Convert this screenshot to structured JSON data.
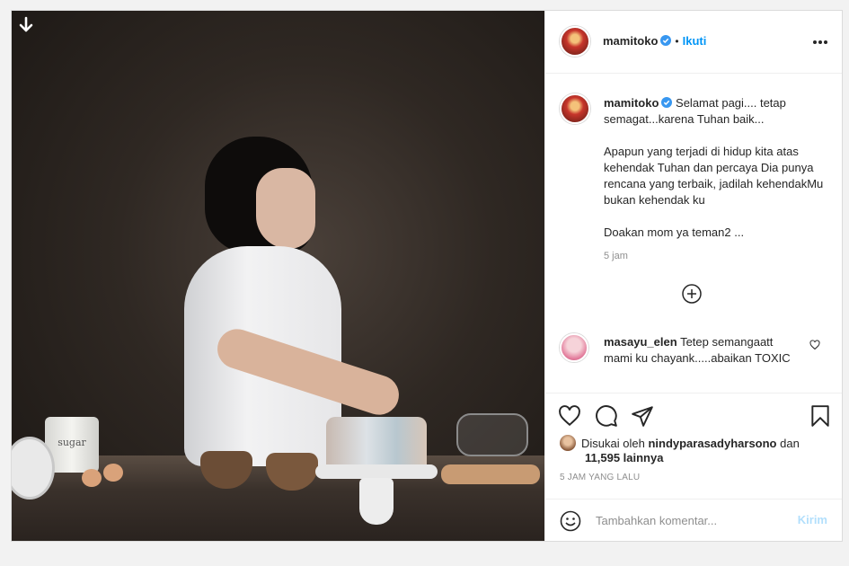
{
  "post": {
    "author": {
      "username": "mamitoko",
      "verified": true,
      "follow_label": "Ikuti",
      "separator": "•"
    },
    "photo": {
      "canister_label": "sugar"
    },
    "caption": {
      "username": "mamitoko",
      "lines": [
        "Selamat pagi.... tetap semagat...karena Tuhan baik...",
        "Apapun yang terjadi di hidup kita atas kehendak Tuhan dan percaya Dia punya rencana yang terbaik, jadilah kehendakMu bukan kehendak ku",
        "Doakan mom ya teman2 ..."
      ],
      "time": "5 jam"
    },
    "comments": [
      {
        "username": "masayu_elen",
        "text": "Tetep semangaatt mami ku chayank.....abaikan TOXIC"
      }
    ],
    "likes": {
      "prefix": "Disukai oleh",
      "first_user": "nindyparasadyharsono",
      "joiner": "dan",
      "others": "11,595 lainnya"
    },
    "posted_ago": "5 JAM YANG LALU",
    "add_comment": {
      "placeholder": "Tambahkan komentar...",
      "post_label": "Kirim"
    }
  },
  "icons": {
    "download": "arrow-down-icon",
    "verified": "verified-badge-icon",
    "more": "more-options-icon",
    "load_more": "plus-circle-icon",
    "like": "heart-icon",
    "comment": "comment-icon",
    "share": "paper-plane-icon",
    "save": "bookmark-icon",
    "emoji": "emoji-icon"
  },
  "colors": {
    "accent": "#0095f6",
    "post_disabled": "#b2dffc",
    "muted": "#8e8e8e"
  }
}
